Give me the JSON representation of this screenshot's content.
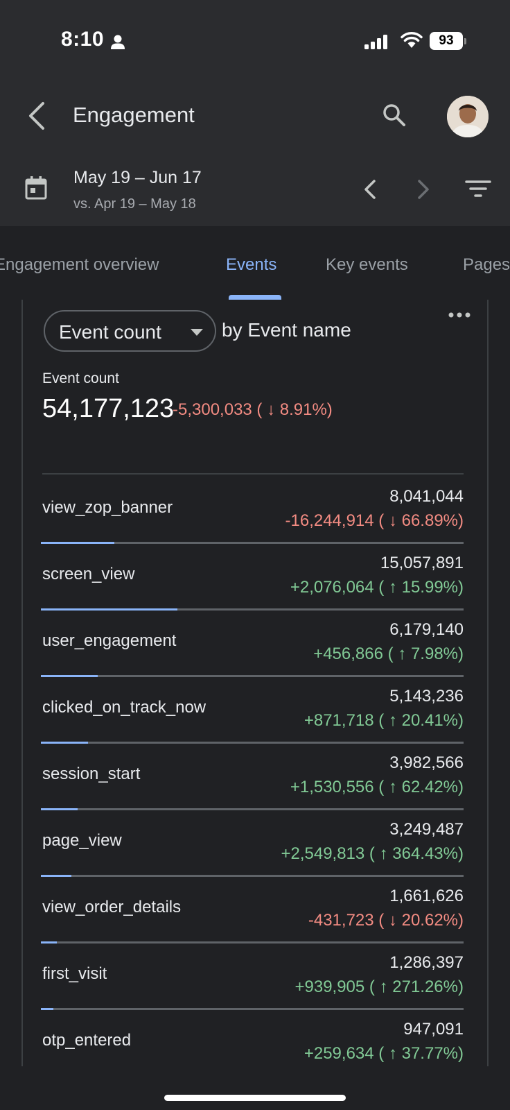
{
  "status_bar": {
    "time": "8:10",
    "battery": "93",
    "icons": [
      "person-icon",
      "signal-icon",
      "wifi-icon",
      "battery-icon"
    ]
  },
  "header": {
    "title": "Engagement",
    "icons": [
      "back-arrow-icon",
      "search-icon",
      "avatar"
    ]
  },
  "date_range": {
    "current": "May 19 – Jun 17",
    "compare": "vs. Apr 19 – May 18",
    "icons": [
      "calendar-icon",
      "chevron-left-icon",
      "chevron-right-icon",
      "filter-icon"
    ]
  },
  "tabs": [
    {
      "label": "Engagement overview",
      "active": false
    },
    {
      "label": "Events",
      "active": true
    },
    {
      "label": "Key events",
      "active": false
    },
    {
      "label": "Pages",
      "active": false
    }
  ],
  "card": {
    "metric_select": "Event count",
    "dimension_label": "by Event name",
    "summary": {
      "label": "Event count",
      "value": "54,177,123",
      "change": "-5,300,033 ( ↓ 8.91%)",
      "trend": "down"
    },
    "rows": [
      {
        "name": "view_zop_banner",
        "value": "8,041,044",
        "change": "-16,244,914 ( ↓ 66.89%)",
        "trend": "down",
        "share": 0.174
      },
      {
        "name": "screen_view",
        "value": "15,057,891",
        "change": "+2,076,064 ( ↑ 15.99%)",
        "trend": "up",
        "share": 0.323
      },
      {
        "name": "user_engagement",
        "value": "6,179,140",
        "change": "+456,866 ( ↑ 7.98%)",
        "trend": "up",
        "share": 0.134
      },
      {
        "name": "clicked_on_track_now",
        "value": "5,143,236",
        "change": "+871,718 ( ↑ 20.41%)",
        "trend": "up",
        "share": 0.112
      },
      {
        "name": "session_start",
        "value": "3,982,566",
        "change": "+1,530,556 ( ↑ 62.42%)",
        "trend": "up",
        "share": 0.087
      },
      {
        "name": "page_view",
        "value": "3,249,487",
        "change": "+2,549,813 ( ↑ 364.43%)",
        "trend": "up",
        "share": 0.072
      },
      {
        "name": "view_order_details",
        "value": "1,661,626",
        "change": "-431,723 ( ↓ 20.62%)",
        "trend": "down",
        "share": 0.037
      },
      {
        "name": "first_visit",
        "value": "1,286,397",
        "change": "+939,905 ( ↑ 271.26%)",
        "trend": "up",
        "share": 0.03
      },
      {
        "name": "otp_entered",
        "value": "947,091",
        "change": "+259,634 ( ↑ 37.77%)",
        "trend": "up",
        "share": 0.02
      }
    ]
  },
  "colors": {
    "accent": "#8ab4f8",
    "positive": "#81c995",
    "negative": "#f28b82",
    "background": "#202124",
    "header_background": "#2b2c2f"
  }
}
